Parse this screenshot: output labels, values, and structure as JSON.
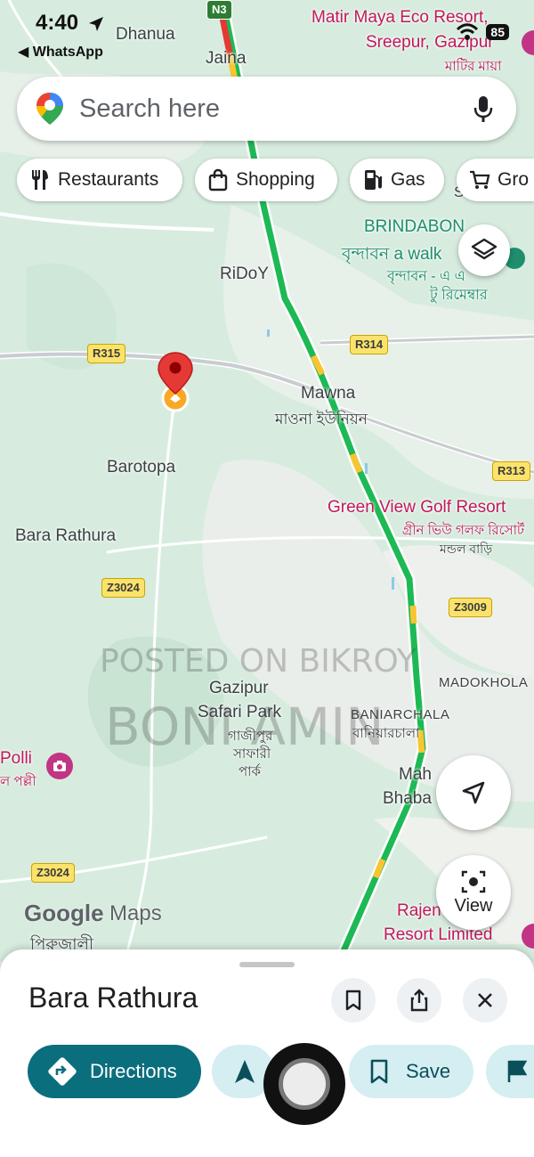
{
  "status_bar": {
    "time": "4:40",
    "back_app": "◀ WhatsApp",
    "battery": "85"
  },
  "search": {
    "placeholder": "Search here"
  },
  "chips": [
    {
      "label": "Restaurants",
      "icon": "fork-knife-icon"
    },
    {
      "label": "Shopping",
      "icon": "shopping-bag-icon"
    },
    {
      "label": "Gas",
      "icon": "gas-pump-icon"
    },
    {
      "label": "Gro",
      "icon": "cart-icon"
    }
  ],
  "map": {
    "labels": {
      "dhanua": "Dhanua",
      "jaina": "Jaina",
      "matir_maya_1": "Matir Maya Eco Resort,",
      "matir_maya_2": "Sreepur, Gazipur",
      "matir_maya_bn": "মাটির মায়া",
      "brindabon": "BRINDABON",
      "brindabon_walk": "বৃন্দাবন a walk",
      "brindabon_bn": "বৃন্দাবন - এ এ",
      "restaurant_bn": "টু রিমেম্বার",
      "sa": "Sa",
      "ridoy": "RiDoY",
      "mawna": "Mawna",
      "mawna_bn": "মাওনা ইউনিয়ন",
      "barotopa": "Barotopa",
      "bara_rathura": "Bara Rathura",
      "green_view": "Green View Golf Resort",
      "green_view_bn": "গ্রীন ভিউ গলফ রিসোর্ট",
      "mondol_bari": "মন্ডল বাড়ি",
      "madokhola": "MADOKHOLA",
      "gazipur_safari_1": "Gazipur",
      "gazipur_safari_2": "Safari Park",
      "safari_bn_1": "গাজীপুর",
      "safari_bn_2": "সাফারী",
      "safari_bn_3": "পার্ক",
      "baniarchala": "BANIARCHALA",
      "baniarchala_bn": "বানিয়ারচালা",
      "maha": "Mah",
      "bhaba": "Bhaba",
      "polli": "Polli",
      "polli_bn": "ল পল্লী",
      "rajend": "Rajen",
      "resort_limited": "Resort Limited",
      "pirujali": "পিরুজালী"
    },
    "shields": {
      "n3": "N3",
      "r315": "R315",
      "r314": "R314",
      "r313": "R313",
      "z3024_a": "Z3024",
      "z3009": "Z3009",
      "z3024_b": "Z3024"
    },
    "watermark_1": "POSTED ON BIKROY",
    "watermark_2": "BONI AMIN",
    "google": "Google",
    "maps": "Maps"
  },
  "view_button": "View",
  "sheet": {
    "title": "Bara Rathura",
    "directions": "Directions",
    "save": "Save"
  },
  "colors": {
    "map_bg": "#d7ecdf",
    "traffic_green": "#1db954",
    "traffic_yellow": "#f7c531",
    "pin_red": "#e53935",
    "primary": "#0b6e7d",
    "light_pill": "#d5eef2"
  }
}
